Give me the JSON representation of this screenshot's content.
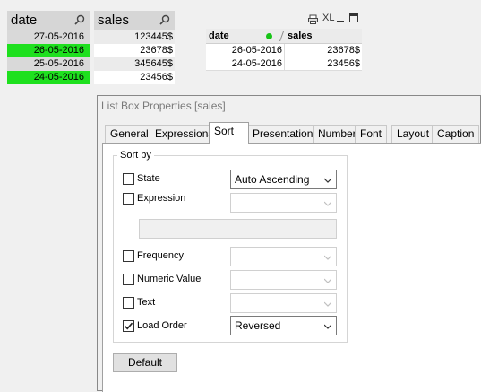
{
  "date_listbox": {
    "title": "date",
    "items": [
      {
        "value": "27-05-2016",
        "state": "alt"
      },
      {
        "value": "26-05-2016",
        "state": "sel"
      },
      {
        "value": "25-05-2016",
        "state": "alt"
      },
      {
        "value": "24-05-2016",
        "state": "sel"
      }
    ]
  },
  "sales_listbox": {
    "title": "sales",
    "items": [
      {
        "value": "123445$",
        "state": "gry"
      },
      {
        "value": "23678$",
        "state": "wht"
      },
      {
        "value": "345645$",
        "state": "gry"
      },
      {
        "value": "23456$",
        "state": "wht"
      }
    ]
  },
  "table": {
    "caption_icons": [
      "print-icon",
      "xl-icon",
      "minimize-icon",
      "maximize-icon"
    ],
    "xl_label": "XL",
    "headers": [
      "date",
      "sales"
    ],
    "rows": [
      [
        "26-05-2016",
        "23678$"
      ],
      [
        "24-05-2016",
        "23456$"
      ]
    ]
  },
  "dialog": {
    "title": "List Box Properties [sales]",
    "tabs": [
      "General",
      "Expressions",
      "Sort",
      "Presentation",
      "Number",
      "Font",
      "Layout",
      "Caption"
    ],
    "active_tab": "Sort",
    "group_label": "Sort by",
    "options": [
      {
        "label": "State",
        "checked": false,
        "combo": "Auto Ascending",
        "enabled": true
      },
      {
        "label": "Expression",
        "checked": false,
        "combo": "",
        "enabled": false
      },
      {
        "label": "Frequency",
        "checked": false,
        "combo": "",
        "enabled": false
      },
      {
        "label": "Numeric Value",
        "checked": false,
        "combo": "",
        "enabled": false
      },
      {
        "label": "Text",
        "checked": false,
        "combo": "",
        "enabled": false
      },
      {
        "label": "Load Order",
        "checked": true,
        "combo": "Reversed",
        "enabled": true
      }
    ],
    "default_button": "Default"
  }
}
